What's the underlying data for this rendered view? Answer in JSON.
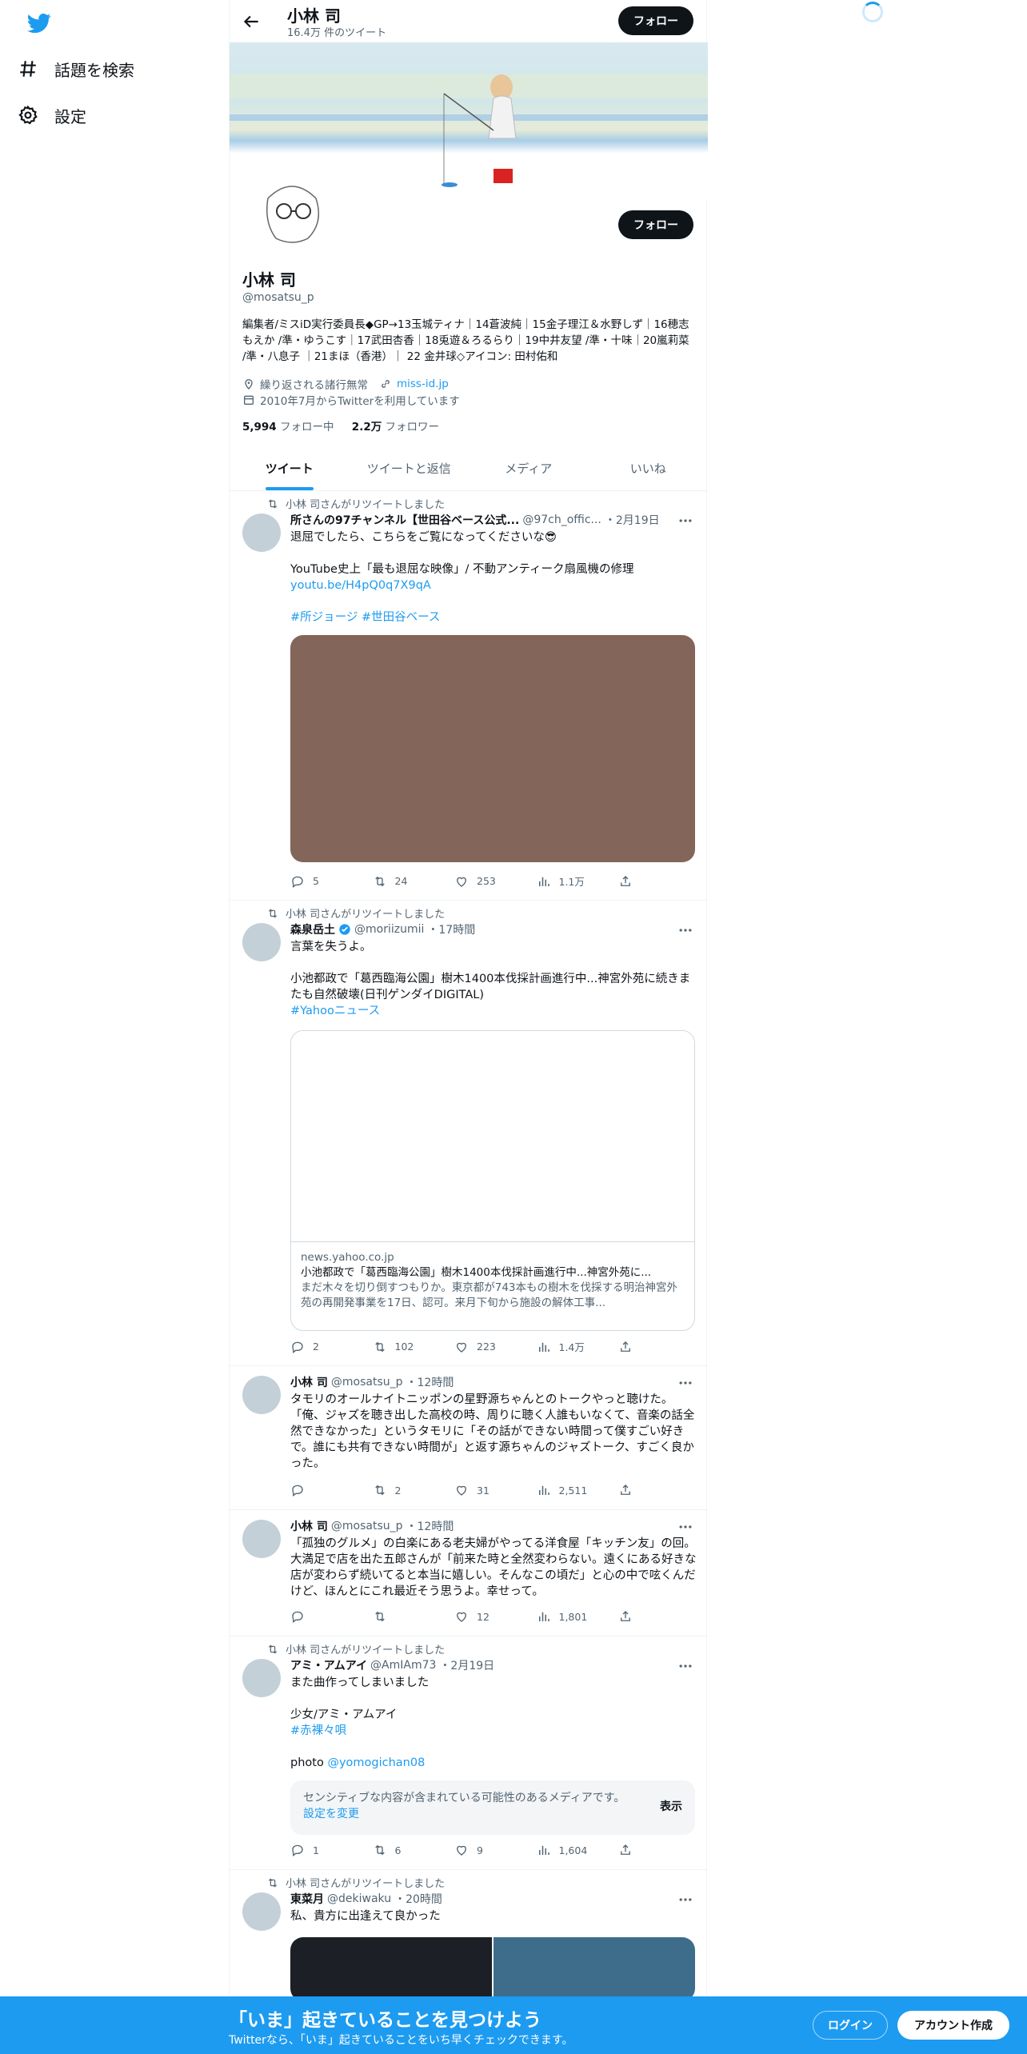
{
  "sidebar": {
    "explore_label": "話題を検索",
    "settings_label": "設定"
  },
  "header": {
    "title": "小林 司",
    "tweet_count": "16.4万 件のツイート",
    "follow_label": "フォロー"
  },
  "profile": {
    "name": "小林 司",
    "handle": "@mosatsu_p",
    "bio": "編集者/ミスiD実行委員長◆GP→13玉城ティナ｜14蒼波純｜15金子理江＆水野しず｜16穂志もえか /準・ゆうこす｜17武田杏香｜18兎遊＆ろるらり｜19中井友望 /準・十味｜20嵐莉菜 /準・八息子 ｜21まほ（香港）｜ 22 金井球◇アイコン: 田村佑和",
    "location": "繰り返される諸行無常",
    "website": "miss-id.jp",
    "joined": "2010年7月からTwitterを利用しています",
    "following_count": "5,994",
    "following_label": "フォロー中",
    "followers_count": "2.2万",
    "followers_label": "フォロワー",
    "follow_label": "フォロー"
  },
  "tabs": [
    "ツイート",
    "ツイートと返信",
    "メディア",
    "いいね"
  ],
  "tweets": [
    {
      "retweet_label": "小林 司さんがリツイートしました",
      "name": "所さんの97チャンネル【世田谷ベース公式...",
      "handle": "@97ch_offic...",
      "time": "・2月19日",
      "text": "退屈でしたら、こちらをご覧になってくださいな😎\n\nYouTube史上「最も退屈な映像」/ 不動アンティーク扇風機の修理",
      "link": "youtu.be/H4pQ0q7X9qA",
      "hashtags": "#所ジョージ #世田谷ベース",
      "media_color": "#846559",
      "stats": [
        "5",
        "24",
        "253",
        "1.1万"
      ]
    },
    {
      "retweet_label": "小林 司さんがリツイートしました",
      "name": "森泉岳土",
      "handle": "@moriizumii",
      "time": "・17時間",
      "text": "言葉を失うよ。\n\n小池都政で「葛西臨海公園」樹木1400本伐採計画進行中...神宮外苑に続きまたも自然破壊(日刊ゲンダイDIGITAL)",
      "hashtags": "#Yahooニュース",
      "card_domain": "news.yahoo.co.jp",
      "card_title": "小池都政で「葛西臨海公園」樹木1400本伐採計画進行中...神宮外苑に...",
      "card_desc": "まだ木々を切り倒すつもりか。東京都が743本もの樹木を伐採する明治神宮外苑の再開発事業を17日、認可。来月下旬から施設の解体工事...",
      "stats": [
        "2",
        "102",
        "223",
        "1.4万"
      ]
    },
    {
      "name": "小林 司",
      "handle": "@mosatsu_p",
      "time": "・12時間",
      "text": "タモリのオールナイトニッポンの星野源ちゃんとのトークやっと聴けた。「俺、ジャズを聴き出した高校の時、周りに聴く人誰もいなくて、音楽の話全然できなかった」というタモリに「その話ができない時間って僕すごい好きで。誰にも共有できない時間が」と返す源ちゃんのジャズトーク、すごく良かった。",
      "stats": [
        "",
        "2",
        "31",
        "2,511"
      ]
    },
    {
      "name": "小林 司",
      "handle": "@mosatsu_p",
      "time": "・12時間",
      "text": "「孤独のグルメ」の白楽にある老夫婦がやってる洋食屋「キッチン友」の回。大満足で店を出た五郎さんが「前来た時と全然変わらない。遠くにある好きな店が変わらず続いてると本当に嬉しい。そんなこの頃だ」と心の中で呟くんだけど、ほんとにこれ最近そう思うよ。幸せって。",
      "stats": [
        "",
        "",
        "12",
        "1,801"
      ]
    },
    {
      "retweet_label": "小林 司さんがリツイートしました",
      "name": "アミ・アムアイ",
      "handle": "@AmIAm73",
      "time": "・2月19日",
      "text": "また曲作ってしまいました\n\n少女/アミ・アムアイ",
      "hashtags": "#赤裸々唄",
      "photo_label": "photo",
      "photo_link": "@yomogichan08",
      "sensitive_text": "センシティブな内容が含まれている可能性のあるメディアです。",
      "sensitive_link": "設定を変更",
      "show_label": "表示",
      "stats": [
        "1",
        "6",
        "9",
        "1,604"
      ]
    },
    {
      "retweet_label": "小林 司さんがリツイートしました",
      "name": "東菜月",
      "handle": "@dekiwaku",
      "time": "・20時間",
      "text": "私、貴方に出逢えて良かった"
    }
  ],
  "bottom_bar": {
    "title": "「いま」起きていることを見つけよう",
    "subtitle": "Twitterなら、「いま」起きていることをいち早くチェックできます。",
    "login_label": "ログイン",
    "signup_label": "アカウント作成"
  },
  "colors": {
    "accent": "#1d9bf0",
    "bottom_bar": "#1d9bf0"
  },
  "icons": [
    "twitter-logo-icon",
    "hash-icon",
    "gear-icon",
    "back-arrow-icon",
    "location-icon",
    "link-icon",
    "calendar-icon",
    "retweet-icon",
    "reply-icon",
    "like-icon",
    "views-icon",
    "share-icon",
    "more-icon"
  ]
}
